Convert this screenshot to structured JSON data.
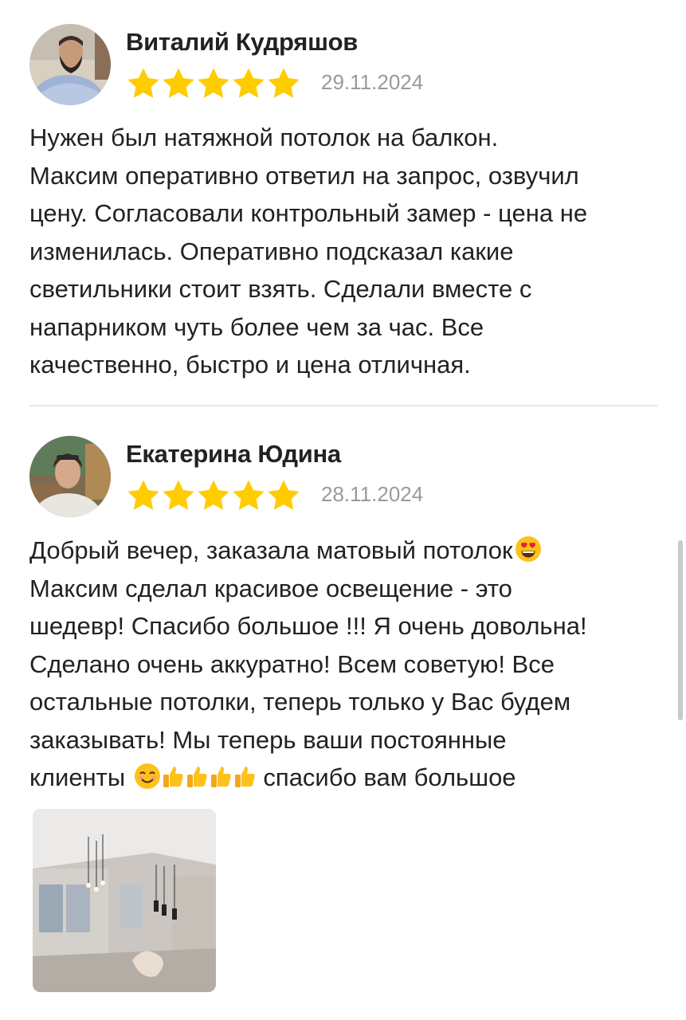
{
  "reviews": [
    {
      "author": "Виталий Кудряшов",
      "rating": 5,
      "date": "29.11.2024",
      "text": "Нужен был натяжной потолок на балкон.\nМаксим оперативно ответил на запрос, озвучил\nцену. Согласовали контрольный замер - цена не\nизменилась. Оперативно подсказал какие\nсветильники стоит взять. Сделали вместе с\nнапарником чуть более чем за час. Все\nкачественно, быстро и цена отличная."
    },
    {
      "author": "Екатерина Юдина",
      "rating": 5,
      "date": "28.11.2024",
      "text_lines": [
        "Добрый вечер, заказала матовый потолок",
        "Максим сделал красивое освещение - это",
        "шедевр! Спасибо большое !!! Я очень довольна!",
        "Сделано очень аккуратно! Всем советую! Все",
        "остальные потолки, теперь только у Вас будем",
        "заказывать! Мы теперь ваши постоянные",
        "клиенты",
        "спасибо вам большое"
      ],
      "emojis": [
        "heart-eyes-emoji",
        "smiling-emoji",
        "thumbs-up-emoji",
        "thumbs-up-emoji",
        "thumbs-up-emoji",
        "thumbs-up-emoji"
      ],
      "photos": [
        "room-ceiling-photo"
      ]
    }
  ],
  "colors": {
    "star": "#ffcc00",
    "date": "#9a9a9a",
    "divider": "#e3e6ea",
    "text": "#222222"
  }
}
